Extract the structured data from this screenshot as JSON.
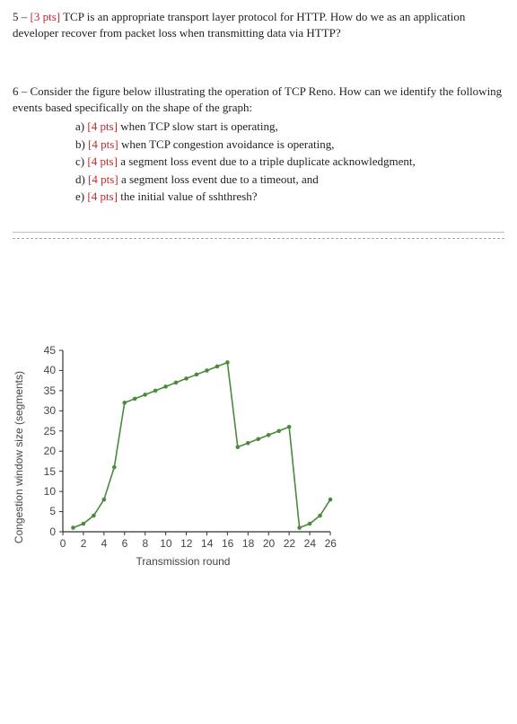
{
  "q5": {
    "prefix": "5 – ",
    "pts": "[3 pts]",
    "text": " TCP is an appropriate transport layer protocol for HTTP.  How do we as an application developer recover from packet loss when transmitting data via HTTP?"
  },
  "q6": {
    "prefix": "6 – ",
    "text": "Consider the figure below illustrating the operation of TCP Reno.  How can we identify the following events based specifically on the shape of the graph:",
    "items": [
      {
        "label": "a)  ",
        "pts": "[4 pts]",
        "text": " when TCP slow start is operating,"
      },
      {
        "label": "b)  ",
        "pts": "[4 pts]",
        "text": " when TCP congestion avoidance is operating,"
      },
      {
        "label": "c)  ",
        "pts": "[4 pts]",
        "text": " a segment loss event due to a triple duplicate acknowledgment,"
      },
      {
        "label": "d)  ",
        "pts": "[4 pts]",
        "text": " a segment loss event due to a timeout, and"
      },
      {
        "label": "e)  ",
        "pts": "[4 pts]",
        "text": " the initial value of sshthresh?"
      }
    ]
  },
  "chart_data": {
    "type": "line",
    "xlabel": "Transmission round",
    "ylabel": "Congestion window size (segments)",
    "xlim": [
      0,
      26
    ],
    "ylim": [
      0,
      45
    ],
    "xticks": [
      0,
      2,
      4,
      6,
      8,
      10,
      12,
      14,
      16,
      18,
      20,
      22,
      24,
      26
    ],
    "yticks": [
      0,
      5,
      10,
      15,
      20,
      25,
      30,
      35,
      40,
      45
    ],
    "x": [
      1,
      2,
      3,
      4,
      5,
      6,
      7,
      8,
      9,
      10,
      11,
      12,
      13,
      14,
      15,
      16,
      17,
      18,
      19,
      20,
      21,
      22,
      23,
      24,
      25,
      26
    ],
    "y": [
      1,
      2,
      4,
      8,
      16,
      32,
      33,
      34,
      35,
      36,
      37,
      38,
      39,
      40,
      41,
      42,
      21,
      22,
      23,
      24,
      25,
      26,
      1,
      2,
      4,
      8
    ]
  }
}
